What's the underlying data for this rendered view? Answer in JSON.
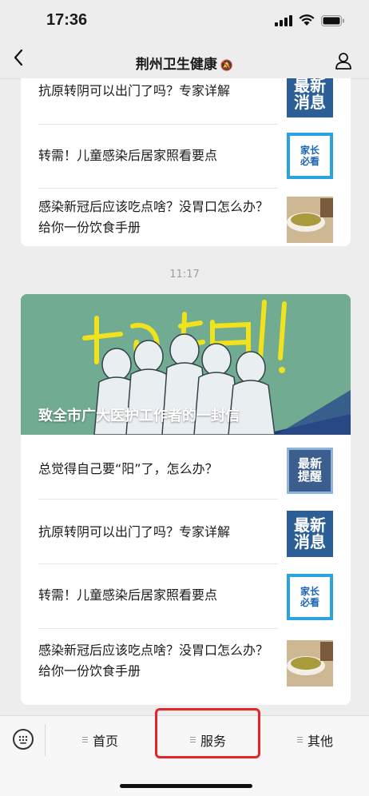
{
  "status": {
    "time": "17:36"
  },
  "nav": {
    "title": "荆州卫生健康"
  },
  "top_card": {
    "items": [
      {
        "title": "抗原转阴可以出门了吗？专家详解",
        "thumb_lines": [
          "最新",
          "消息"
        ]
      },
      {
        "title": "转需！儿童感染后居家照看要点",
        "thumb_lines": [
          "家长",
          "必看"
        ]
      },
      {
        "title": "感染新冠后应该吃点啥？没胃口怎么办？给你一份饮食手册"
      }
    ]
  },
  "timestamp": "11:17",
  "article": {
    "hero_title": "致全市广大医护工作者的一封信",
    "hero_slogan": "加油!",
    "items": [
      {
        "title": "总觉得自己要“阳”了，怎么办？",
        "thumb_lines": [
          "最新",
          "提醒"
        ]
      },
      {
        "title": "抗原转阴可以出门了吗？专家详解",
        "thumb_lines": [
          "最新",
          "消息"
        ]
      },
      {
        "title": "转需！儿童感染后居家照看要点",
        "thumb_lines": [
          "家长",
          "必看"
        ]
      },
      {
        "title": "感染新冠后应该吃点啥？没胃口怎么办？给你一份饮食手册"
      }
    ]
  },
  "tabbar": {
    "tabs": [
      {
        "label": "首页"
      },
      {
        "label": "服务"
      },
      {
        "label": "其他"
      }
    ]
  },
  "colors": {
    "highlight": "#e8242b",
    "latest_blue": "#2c5f98",
    "parent_blue": "#2aa4e0"
  }
}
